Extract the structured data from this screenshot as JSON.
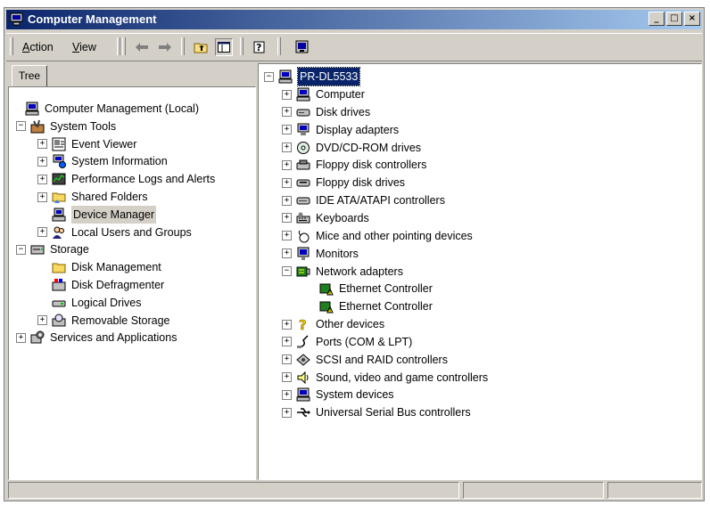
{
  "window": {
    "title": "Computer Management",
    "buttons": {
      "minimize": "_",
      "maximize": "□",
      "close": "×"
    }
  },
  "toolbar": {
    "menus": [
      {
        "label": "Action",
        "accel": "A"
      },
      {
        "label": "View",
        "accel": "V"
      }
    ],
    "icons": [
      "back-arrow-icon",
      "forward-arrow-icon",
      "up-folder-icon",
      "show-hide-tree-icon",
      "help-icon",
      "properties-icon"
    ]
  },
  "left_pane": {
    "tab": "Tree",
    "items": [
      {
        "label": "Computer Management (Local)",
        "level": 0,
        "expander": "",
        "icon": "computer-icon"
      },
      {
        "label": "System Tools",
        "level": 1,
        "expander": "−",
        "icon": "tools-icon"
      },
      {
        "label": "Event Viewer",
        "level": 2,
        "expander": "+",
        "icon": "event-viewer-icon"
      },
      {
        "label": "System Information",
        "level": 2,
        "expander": "+",
        "icon": "system-info-icon"
      },
      {
        "label": "Performance Logs and Alerts",
        "level": 2,
        "expander": "+",
        "icon": "performance-icon"
      },
      {
        "label": "Shared Folders",
        "level": 2,
        "expander": "+",
        "icon": "shared-folder-icon"
      },
      {
        "label": "Device Manager",
        "level": 2,
        "expander": "",
        "icon": "device-manager-icon",
        "highlighted": true
      },
      {
        "label": "Local Users and Groups",
        "level": 2,
        "expander": "+",
        "icon": "users-icon"
      },
      {
        "label": "Storage",
        "level": 1,
        "expander": "−",
        "icon": "storage-icon"
      },
      {
        "label": "Disk Management",
        "level": 2,
        "expander": "",
        "icon": "disk-management-icon"
      },
      {
        "label": "Disk Defragmenter",
        "level": 2,
        "expander": "",
        "icon": "defragmenter-icon"
      },
      {
        "label": "Logical Drives",
        "level": 2,
        "expander": "",
        "icon": "logical-drive-icon"
      },
      {
        "label": "Removable Storage",
        "level": 2,
        "expander": "+",
        "icon": "removable-storage-icon"
      },
      {
        "label": "Services and Applications",
        "level": 1,
        "expander": "+",
        "icon": "services-icon"
      }
    ]
  },
  "right_pane": {
    "root": {
      "label": "PR-DL5533",
      "icon": "computer-icon"
    },
    "items": [
      {
        "label": "Computer",
        "level": 1,
        "expander": "+",
        "icon": "computer-icon"
      },
      {
        "label": "Disk drives",
        "level": 1,
        "expander": "+",
        "icon": "disk-drive-icon"
      },
      {
        "label": "Display adapters",
        "level": 1,
        "expander": "+",
        "icon": "display-adapter-icon"
      },
      {
        "label": "DVD/CD-ROM drives",
        "level": 1,
        "expander": "+",
        "icon": "cdrom-icon"
      },
      {
        "label": "Floppy disk controllers",
        "level": 1,
        "expander": "+",
        "icon": "floppy-controller-icon"
      },
      {
        "label": "Floppy disk drives",
        "level": 1,
        "expander": "+",
        "icon": "floppy-drive-icon"
      },
      {
        "label": "IDE ATA/ATAPI controllers",
        "level": 1,
        "expander": "+",
        "icon": "ide-controller-icon"
      },
      {
        "label": "Keyboards",
        "level": 1,
        "expander": "+",
        "icon": "keyboard-icon"
      },
      {
        "label": "Mice and other pointing devices",
        "level": 1,
        "expander": "+",
        "icon": "mouse-icon"
      },
      {
        "label": "Monitors",
        "level": 1,
        "expander": "+",
        "icon": "monitor-icon"
      },
      {
        "label": "Network adapters",
        "level": 1,
        "expander": "−",
        "icon": "network-adapter-icon"
      },
      {
        "label": "Ethernet Controller",
        "level": 2,
        "expander": "",
        "icon": "ethernet-warning-icon"
      },
      {
        "label": "Ethernet Controller",
        "level": 2,
        "expander": "",
        "icon": "ethernet-warning-icon"
      },
      {
        "label": "Other devices",
        "level": 1,
        "expander": "+",
        "icon": "question-mark-icon"
      },
      {
        "label": "Ports (COM & LPT)",
        "level": 1,
        "expander": "+",
        "icon": "port-icon"
      },
      {
        "label": "SCSI and RAID controllers",
        "level": 1,
        "expander": "+",
        "icon": "scsi-icon"
      },
      {
        "label": "Sound, video and game controllers",
        "level": 1,
        "expander": "+",
        "icon": "sound-icon"
      },
      {
        "label": "System devices",
        "level": 1,
        "expander": "+",
        "icon": "system-device-icon"
      },
      {
        "label": "Universal Serial Bus controllers",
        "level": 1,
        "expander": "+",
        "icon": "usb-icon"
      }
    ]
  },
  "colors": {
    "title_start": "#0a246a",
    "title_end": "#a6caf0",
    "selection": "#0a246a",
    "face": "#d4d0c8"
  }
}
